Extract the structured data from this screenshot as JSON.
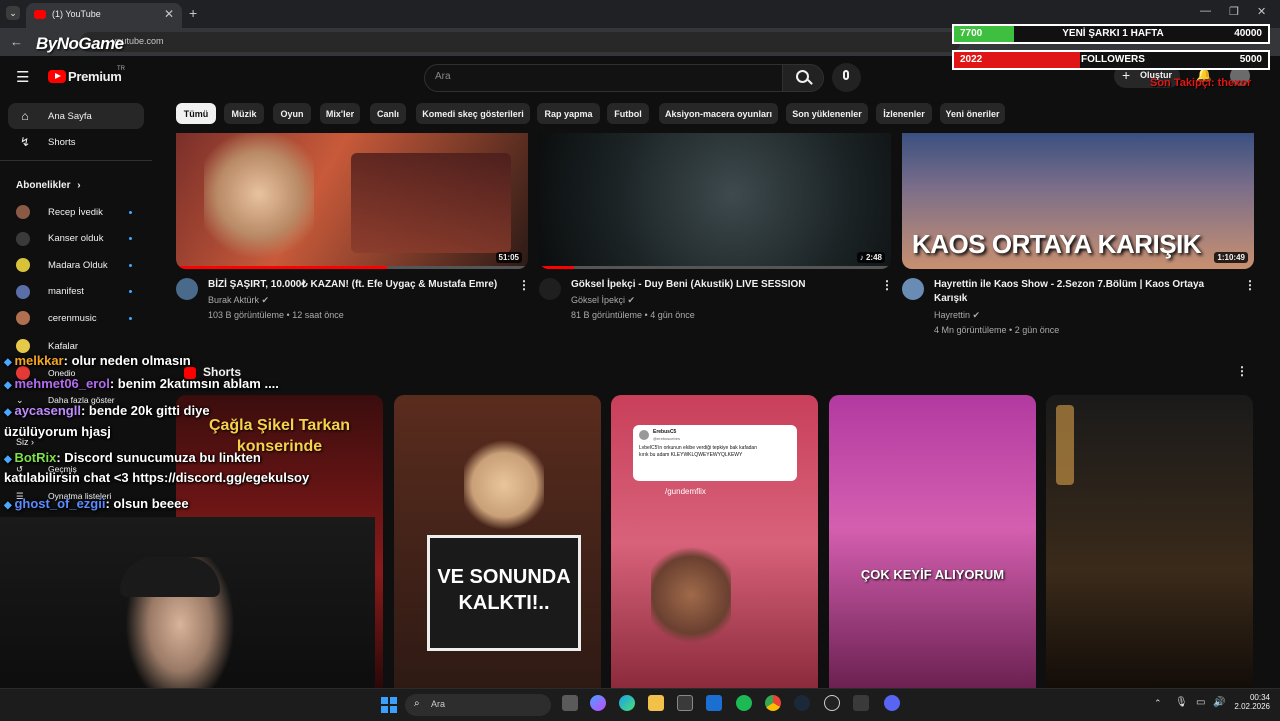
{
  "browser": {
    "tab_title": "(1) YouTube",
    "url": "youtube.com",
    "overlay_logo": "ByNoGame"
  },
  "youtube": {
    "brand": "Premium",
    "brand_sup": "TR",
    "search_placeholder": "Ara",
    "create_label": "Oluştur",
    "sidebar": {
      "home": "Ana Sayfa",
      "shorts": "Shorts",
      "subscriptions_title": "Abonelikler",
      "subs": [
        {
          "name": "Recep İvedik",
          "color": "#8a5a44"
        },
        {
          "name": "Kanser olduk",
          "color": "#3a3a3a"
        },
        {
          "name": "Madara Olduk",
          "color": "#d8c23a"
        },
        {
          "name": "manifest",
          "color": "#5a6ea8"
        },
        {
          "name": "cerenmusic",
          "color": "#b07050"
        }
      ],
      "kafalar": "Kafalar",
      "onedio": "Onedio",
      "more": "Daha fazla göster",
      "you": "Siz",
      "history": "Geçmiş",
      "playlists": "Oynatma listeleri"
    },
    "chips": [
      "Tümü",
      "Müzik",
      "Oyun",
      "Mix'ler",
      "Canlı",
      "Komedi skeç gösterileri",
      "Rap yapma",
      "Futbol",
      "Aksiyon-macera oyunları",
      "Son yüklenenler",
      "İzlenenler",
      "Yeni öneriler"
    ],
    "videos": [
      {
        "title": "BİZİ ŞAŞIRT, 10.000₺ KAZAN! (ft. Efe Uygaç & Mustafa Emre)",
        "channel": "Burak Aktürk",
        "meta": "103 B görüntüleme • 12 saat önce",
        "duration": "51:05"
      },
      {
        "title": "Göksel İpekçi - Duy Beni (Akustik) LIVE SESSION",
        "channel": "Göksel İpekçi",
        "meta": "81 B görüntüleme • 4 gün önce",
        "duration": "2:48"
      },
      {
        "title": "Hayrettin ile Kaos Show - 2.Sezon 7.Bölüm | Kaos Ortaya Karışık",
        "channel": "Hayrettin",
        "meta": "4 Mn görüntüleme • 2 gün önce",
        "duration": "1:10:49",
        "thumb_text": "KAOS ORTAYA KARIŞIK"
      }
    ],
    "shorts_title": "Shorts",
    "shorts": [
      {
        "caption": "Çağla Şikel Tarkan konserinde"
      },
      {
        "caption": "VE SONUNDA KALKTI!.."
      },
      {
        "tweet_user": "ErebusC5",
        "tweet_handle": "@erebuscebes",
        "tweet_text": "LvbelC5'in orkunun ekibe verdiği tepkiye bak kafadan kırık bu adam KLEYWKLQWEYEWYQLKEWY",
        "source": "/gundemflix"
      },
      {
        "caption": "ÇOK KEYİF ALIYORUM"
      },
      {
        "caption": ""
      }
    ]
  },
  "stream": {
    "goals": [
      {
        "count": "7700",
        "label": "YENİ ŞARKI 1 HAFTA",
        "goal": "40000",
        "progress": 0.19,
        "color": "#3fbf3f"
      },
      {
        "count": "2022",
        "label": "FOLLOWERS",
        "goal": "5000",
        "progress": 0.4,
        "color": "#e01515"
      }
    ],
    "last_follower": "Son Takipçi: thexor",
    "chat": [
      {
        "user": "melkkar",
        "color": "#f5a623",
        "text": ": olur neden olmasın"
      },
      {
        "user": "mehmet06_erol",
        "color": "#b36cf0",
        "text": ": benim 2katımsın ablam ...."
      },
      {
        "user": "aycasengll",
        "color": "#c08cff",
        "text": ": bende 20k gitti diye"
      },
      {
        "user": "",
        "color": "#fff",
        "text": "üzülüyorum hjasj"
      },
      {
        "user": "BotRix",
        "color": "#7ee04a",
        "text": ": Discord sunucumuza bu linkten"
      },
      {
        "user": "",
        "color": "#fff",
        "text": "katılabilirsin chat <3 https://discord.gg/egekulsoy"
      },
      {
        "user": "ghost_of_ezgii",
        "color": "#5b8cff",
        "text": ": olsun beeee"
      }
    ]
  },
  "taskbar": {
    "search_placeholder": "Ara",
    "time": "00:34",
    "date": "2.02.2026"
  }
}
